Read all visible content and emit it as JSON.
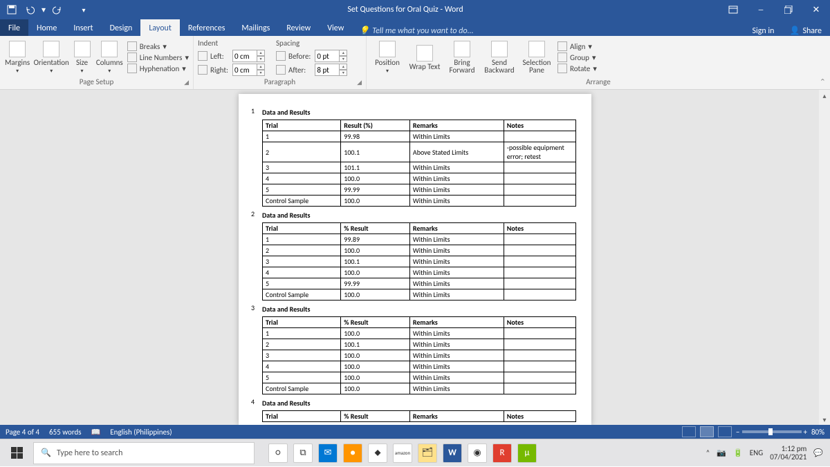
{
  "titlebar": {
    "title": "Set Questions for Oral Quiz - Word"
  },
  "tabs": {
    "file": "File",
    "home": "Home",
    "insert": "Insert",
    "design": "Design",
    "layout": "Layout",
    "references": "References",
    "mailings": "Mailings",
    "review": "Review",
    "view": "View",
    "tell": "Tell me what you want to do...",
    "signin": "Sign in",
    "share": "Share"
  },
  "ribbon": {
    "page_setup": {
      "label": "Page Setup",
      "margins": "Margins",
      "orientation": "Orientation",
      "size": "Size",
      "columns": "Columns",
      "breaks": "Breaks",
      "line_numbers": "Line Numbers",
      "hyphenation": "Hyphenation"
    },
    "paragraph": {
      "label": "Paragraph",
      "indent_hdr": "Indent",
      "spacing_hdr": "Spacing",
      "left_lbl": "Left:",
      "left_val": "0 cm",
      "right_lbl": "Right:",
      "right_val": "0 cm",
      "before_lbl": "Before:",
      "before_val": "0 pt",
      "after_lbl": "After:",
      "after_val": "8 pt"
    },
    "arrange": {
      "label": "Arrange",
      "position": "Position",
      "wrap": "Wrap Text",
      "bring": "Bring Forward",
      "send": "Send Backward",
      "selection": "Selection Pane",
      "align": "Align",
      "group": "Group",
      "rotate": "Rotate"
    }
  },
  "document": {
    "blocks": [
      {
        "num": "1",
        "heading": "Data and Results",
        "headers": [
          "Trial",
          "Result (%)",
          "Remarks",
          "Notes"
        ],
        "rows": [
          [
            "1",
            "99.98",
            "Within Limits",
            ""
          ],
          [
            "2",
            "100.1",
            "Above Stated Limits",
            "-possible equipment error; retest"
          ],
          [
            "3",
            "101.1",
            "Within Limits",
            ""
          ],
          [
            "4",
            "100.0",
            "Within Limits",
            ""
          ],
          [
            "5",
            "99.99",
            "Within Limits",
            ""
          ],
          [
            "Control Sample",
            "100.0",
            "Within Limits",
            ""
          ]
        ]
      },
      {
        "num": "2",
        "heading": "Data and Results",
        "headers": [
          "Trial",
          "% Result",
          "Remarks",
          "Notes"
        ],
        "rows": [
          [
            "1",
            "99.89",
            "Within Limits",
            ""
          ],
          [
            "2",
            "100.0",
            "Within Limits",
            ""
          ],
          [
            "3",
            "100.1",
            "Within Limits",
            ""
          ],
          [
            "4",
            "100.0",
            "Within Limits",
            ""
          ],
          [
            "5",
            "99.99",
            "Within Limits",
            ""
          ],
          [
            "Control Sample",
            "100.0",
            "Within Limits",
            ""
          ]
        ]
      },
      {
        "num": "3",
        "heading": "Data and Results",
        "headers": [
          "Trial",
          "% Result",
          "Remarks",
          "Notes"
        ],
        "rows": [
          [
            "1",
            "100.0",
            "Within Limits",
            ""
          ],
          [
            "2",
            "100.1",
            "Within Limits",
            ""
          ],
          [
            "3",
            "100.0",
            "Within Limits",
            ""
          ],
          [
            "4",
            "100.0",
            "Within Limits",
            ""
          ],
          [
            "5",
            "100.0",
            "Within Limits",
            ""
          ],
          [
            "Control Sample",
            "100.0",
            "Within Limits",
            ""
          ]
        ]
      },
      {
        "num": "4",
        "heading": "Data and Results",
        "headers": [
          "Trial",
          "% Result",
          "Remarks",
          "Notes"
        ],
        "rows": []
      }
    ]
  },
  "status": {
    "page": "Page 4 of 4",
    "words": "655 words",
    "lang": "English (Philippines)",
    "zoom": "80%"
  },
  "taskbar": {
    "search_placeholder": "Type here to search",
    "lang": "ENG",
    "time": "1:12 pm",
    "date": "07/04/2021"
  }
}
